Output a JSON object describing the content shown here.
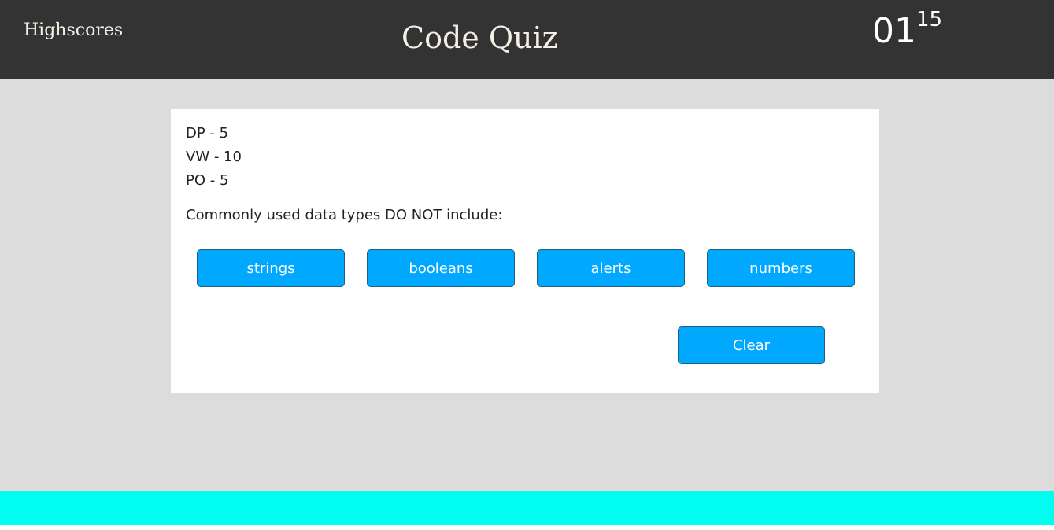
{
  "header": {
    "highscores_label": "Highscores",
    "title": "Code Quiz",
    "timer": {
      "minutes": "01",
      "seconds": "15"
    }
  },
  "scores": [
    {
      "text": "DP - 5"
    },
    {
      "text": "VW - 10"
    },
    {
      "text": "PO - 5"
    }
  ],
  "question": {
    "text": "Commonly used data types DO NOT include:",
    "answers": [
      {
        "label": "strings"
      },
      {
        "label": "booleans"
      },
      {
        "label": "alerts"
      },
      {
        "label": "numbers"
      }
    ]
  },
  "clear_label": "Clear",
  "colors": {
    "header_bg": "#333333",
    "page_bg": "#dcdcdc",
    "button_bg": "#00a8ff",
    "footer_bg": "#00fdf0"
  }
}
